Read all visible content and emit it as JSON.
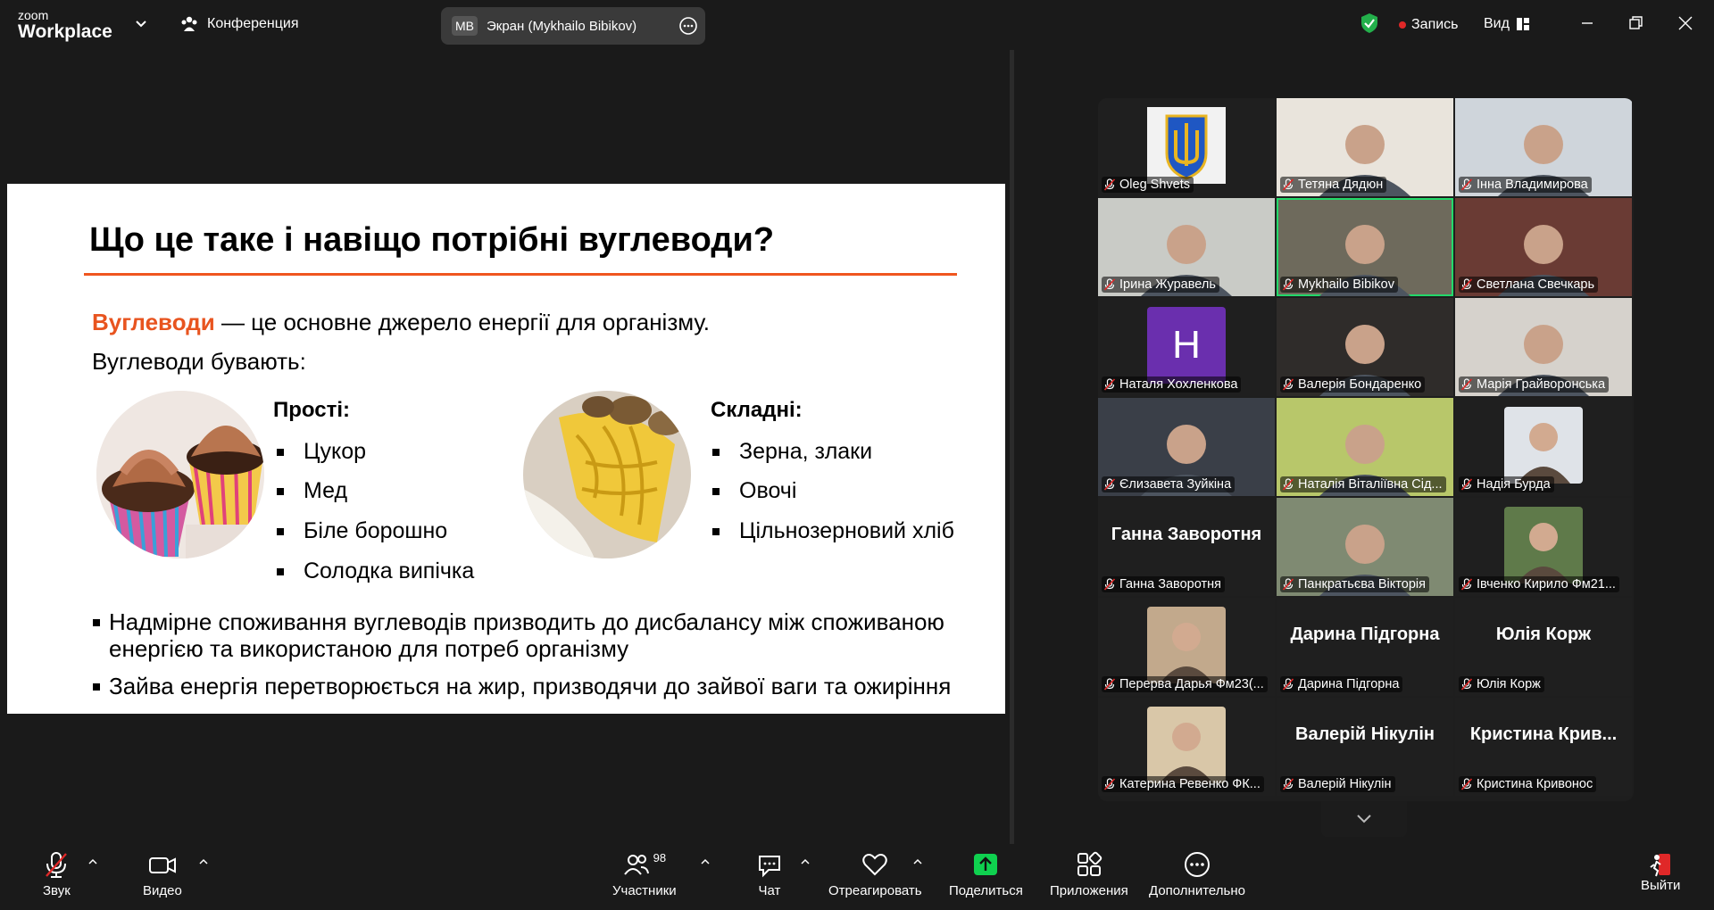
{
  "app": {
    "logo_small": "zoom",
    "logo_big": "Workplace"
  },
  "top": {
    "meeting_label": "Конференция",
    "screen_badge": "MB",
    "screen_label": "Экран (Mykhailo Bibikov)",
    "record_label": "Запись",
    "view_label": "Вид"
  },
  "slide": {
    "title": "Що це таке і навіщо потрібні вуглеводи?",
    "def_highlight": "Вуглеводи",
    "def_rest": " — це основне джерело енергії для організму.",
    "types_line": "Вуглеводи бувають:",
    "simple_head": "Прості:",
    "simple_items": [
      "Цукор",
      "Мед",
      "Біле борошно",
      "Солодка випічка"
    ],
    "complex_head": "Складні:",
    "complex_items": [
      "Зерна, злаки",
      "Овочі",
      "Цільнозерновий хліб"
    ],
    "bullet1": "Надмірне споживання вуглеводів призводить до дисбалансу між споживаною енергією та використаною для потреб організму",
    "bullet2": "Зайва енергія перетворюється на жир, призводячи до зайвої ваги та ожиріння"
  },
  "participants": [
    {
      "name": "Oleg Shvets",
      "kind": "emblem"
    },
    {
      "name": "Тетяна Дядюн",
      "kind": "video"
    },
    {
      "name": "Інна Владимирова",
      "kind": "video"
    },
    {
      "name": "Ірина Журавель",
      "kind": "video"
    },
    {
      "name": "Mykhailo Bibikov",
      "kind": "video",
      "active": true
    },
    {
      "name": "Светлана Свечкарь",
      "kind": "video"
    },
    {
      "name": "Наталя Хохленкова",
      "kind": "letter",
      "letter": "H"
    },
    {
      "name": "Валерія Бондаренко",
      "kind": "video"
    },
    {
      "name": "Марія Грайворонська",
      "kind": "video"
    },
    {
      "name": "Єлизавета Зуйкіна",
      "kind": "video"
    },
    {
      "name": "Наталія Віталіївна Сід...",
      "kind": "video"
    },
    {
      "name": "Надія Бурда",
      "kind": "photo"
    },
    {
      "name": "Ганна Заворотня",
      "kind": "text",
      "display": "Ганна Заворотня"
    },
    {
      "name": "Панкратьєва Вікторія",
      "kind": "video"
    },
    {
      "name": "Івченко Кирило Фм21...",
      "kind": "photo"
    },
    {
      "name": "Перерва Дарья Фм23(...",
      "kind": "photo"
    },
    {
      "name": "Дарина Підгорна",
      "kind": "text",
      "display": "Дарина Підгорна"
    },
    {
      "name": "Юлія Корж",
      "kind": "text",
      "display": "Юлія Корж"
    },
    {
      "name": "Катерина Ревенко ФК...",
      "kind": "photo"
    },
    {
      "name": "Валерій Нікулін",
      "kind": "text",
      "display": "Валерій Нікулін"
    },
    {
      "name": "Кристина Кривонос",
      "kind": "text",
      "display": "Кристина  Крив..."
    }
  ],
  "toolbar": {
    "audio": "Звук",
    "video": "Видео",
    "participants": "Участники",
    "participants_count": "98",
    "chat": "Чат",
    "react": "Отреагировать",
    "share": "Поделиться",
    "apps": "Приложения",
    "more": "Дополнительно",
    "leave": "Выйти"
  },
  "colors": {
    "accent_orange": "#e8541f",
    "share_green": "#0fd14f",
    "active_border": "#23d96a",
    "record_red": "#e02828"
  }
}
